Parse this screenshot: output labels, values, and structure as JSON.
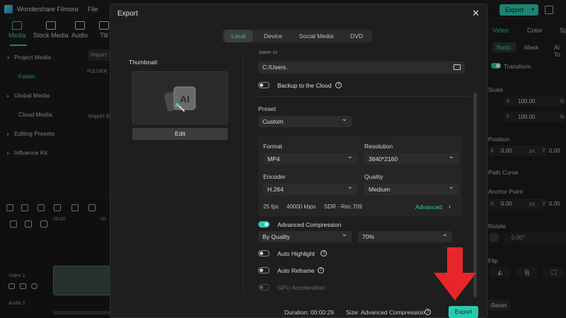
{
  "app": {
    "name": "Wondershare Filmora",
    "menu_file": "File",
    "top_export_label": "Export",
    "toolbar": [
      "Media",
      "Stock Media",
      "Audio",
      "Titl"
    ],
    "nav": {
      "project_media": "Project Media",
      "folder": "Folder",
      "global_media": "Global Media",
      "cloud_media": "Cloud Media",
      "editing_presets": "Editing Presets",
      "influence_kit": "Influence Kit"
    },
    "media_panel": {
      "import_button": "Import",
      "folder_header": "FOLDER",
      "import_hint": "Import M"
    },
    "timeline": {
      "ruler_start": "00:00",
      "ruler_next": "00",
      "video_track": "Video 1",
      "audio_track": "Audio 1"
    },
    "right_panel": {
      "tabs": [
        "Video",
        "Color",
        "Sp"
      ],
      "subtabs": [
        "Basic",
        "Mask",
        "AI To"
      ],
      "transform": "Transform",
      "scale": "Scale",
      "scale_x_axis": "X",
      "scale_y_axis": "Y",
      "scale_x": "100.00",
      "scale_y": "100.00",
      "scale_unit": "%",
      "position": "Position",
      "pos_x_axis": "X",
      "pos_x": "0.00",
      "pos_unit": "px",
      "pos_y_axis": "Y",
      "pos_y": "0.00",
      "path_curve": "Path Curve",
      "anchor_point": "Anchor Point",
      "anchor_x_axis": "X",
      "anchor_x": "0.00",
      "anchor_unit": "px",
      "anchor_y_axis": "Y",
      "anchor_y": "0.00",
      "rotate": "Rotate",
      "rotate_value": "0.00°",
      "flip": "Flip",
      "reset": "Reset"
    }
  },
  "dialog": {
    "title": "Export",
    "close_glyph": "✕",
    "tabs": [
      {
        "label": "Local",
        "active": true
      },
      {
        "label": "Device",
        "active": false
      },
      {
        "label": "Social Media",
        "active": false
      },
      {
        "label": "DVD",
        "active": false
      }
    ],
    "thumbnail_label": "Thumbnail:",
    "thumbnail_badge": "AI",
    "edit_button": "Edit",
    "save_to_label": "Save to",
    "save_path": "C:/Users.",
    "backup_label": "Backup to the Cloud",
    "preset_label": "Preset",
    "preset_value": "Custom",
    "format_label": "Format",
    "format_value": "MP4",
    "resolution_label": "Resolution",
    "resolution_value": "3840*2160",
    "encoder_label": "Encoder",
    "encoder_value": "H.264",
    "quality_label": "Quality",
    "quality_value": "Medium",
    "fps": "25 fps",
    "bitrate": "40000 kbps",
    "color_space": "SDR - Rec.709",
    "advanced_link": "Advanced",
    "advanced_compression_label": "Advanced Compression",
    "compression_mode": "By Quality",
    "compression_percent": "70%",
    "auto_highlight_label": "Auto Highlight",
    "auto_reframe_label": "Auto Reframe",
    "gpu_label": "GPU Acceleration",
    "help_glyph": "?",
    "footer": {
      "duration_label": "Duration:",
      "duration_value": "00:00:29",
      "size_label": "Size:",
      "size_value": "Advanced Compression",
      "export_button": "Export"
    }
  },
  "colors": {
    "accent": "#2bcab0",
    "annotation_arrow": "#e8262a",
    "dialog_bg": "#1e1e1e"
  }
}
